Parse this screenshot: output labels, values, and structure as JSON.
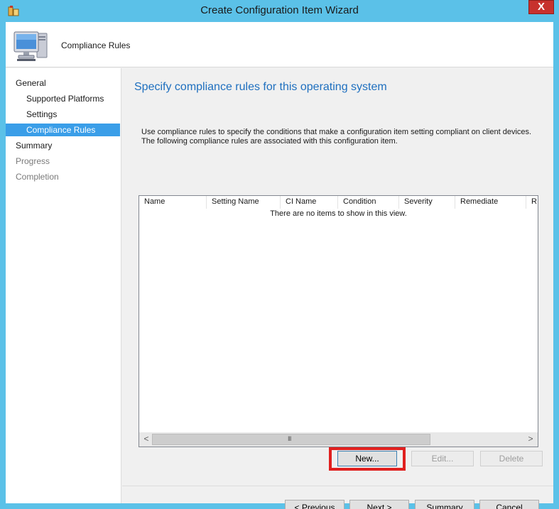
{
  "window": {
    "title": "Create Configuration Item Wizard",
    "close_label": "X"
  },
  "header": {
    "title": "Compliance Rules",
    "icon": "computer-monitor-icon"
  },
  "nav": {
    "items": [
      {
        "label": "General",
        "state": "normal"
      },
      {
        "label": "Supported Platforms",
        "state": "normal"
      },
      {
        "label": "Settings",
        "state": "normal"
      },
      {
        "label": "Compliance Rules",
        "state": "selected"
      },
      {
        "label": "Summary",
        "state": "normal"
      },
      {
        "label": "Progress",
        "state": "disabled"
      },
      {
        "label": "Completion",
        "state": "disabled"
      }
    ]
  },
  "main": {
    "heading": "Specify compliance rules for this operating system",
    "description": "Use compliance rules to specify the conditions that make a configuration item setting compliant on client devices. The following compliance rules are associated with this configuration item.",
    "list": {
      "columns": [
        "Name",
        "Setting Name",
        "CI Name",
        "Condition",
        "Severity",
        "Remediate",
        "R"
      ],
      "empty_message": "There are no items to show in this view.",
      "scroll_left": "<",
      "scroll_right": ">",
      "scroll_grip": "III"
    },
    "actions": {
      "new_label": "New...",
      "edit_label": "Edit...",
      "delete_label": "Delete"
    }
  },
  "footer": {
    "previous_label": "< Previous",
    "next_label": "Next >",
    "summary_label": "Summary",
    "cancel_label": "Cancel"
  },
  "colors": {
    "frame": "#5bc1e8",
    "accent": "#3a9ee8",
    "heading": "#1e6fbf",
    "highlight": "#e0201f",
    "close": "#c7312d"
  }
}
